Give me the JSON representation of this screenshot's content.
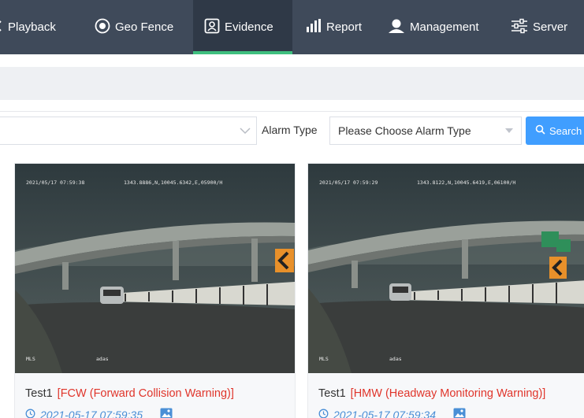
{
  "nav": {
    "items": [
      {
        "label": "Playback",
        "icon": "playback-icon"
      },
      {
        "label": "Geo Fence",
        "icon": "geo-fence-icon"
      },
      {
        "label": "Evidence",
        "icon": "evidence-icon",
        "active": true
      },
      {
        "label": "Report",
        "icon": "report-icon"
      },
      {
        "label": "Management",
        "icon": "management-icon"
      },
      {
        "label": "Server",
        "icon": "server-icon"
      }
    ]
  },
  "filter": {
    "alarm_type_label": "Alarm Type",
    "alarm_type_placeholder": "Please Choose Alarm Type",
    "search_label": "Search"
  },
  "cards": [
    {
      "overlay_top": "2021/05/17 07:59:38",
      "overlay_gps": "1343.8886,N,10045.6342,E,05900/H",
      "overlay_left": "MLS",
      "overlay_mid": "adas",
      "device": "Test1",
      "alarm": "[FCW (Forward Collision Warning)]",
      "time": "2021-05-17 07:59:35"
    },
    {
      "overlay_top": "2021/05/17 07:59:29",
      "overlay_gps": "1343.8122,N,10045.6419,E,06100/H",
      "overlay_left": "MLS",
      "overlay_mid": "adas",
      "device": "Test1",
      "alarm": "[HMW (Headway Monitoring Warning)]",
      "time": "2021-05-17 07:59:34"
    }
  ],
  "colors": {
    "nav_bg": "#3f4a5a",
    "active_underline": "#3fbf7f",
    "alarm_text": "#e0352b",
    "time_text": "#4a8fd6",
    "search_button": "#409eff"
  }
}
